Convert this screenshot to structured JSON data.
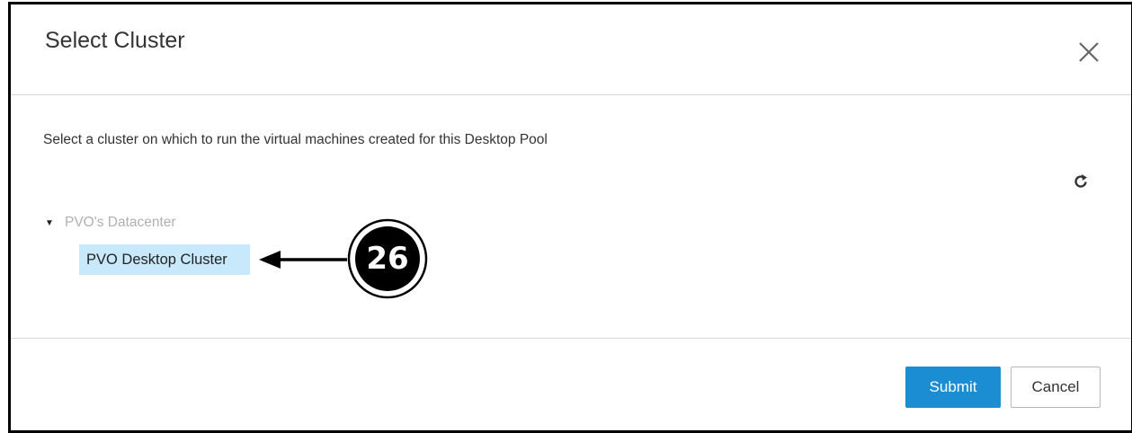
{
  "dialog": {
    "title": "Select Cluster",
    "close_icon": "close-icon",
    "description": "Select a cluster on which to run the virtual machines created for this Desktop Pool",
    "refresh_icon": "refresh-icon"
  },
  "tree": {
    "root": {
      "label": "PVO's Datacenter",
      "expanded": true,
      "icon": "caret-down-icon"
    },
    "children": [
      {
        "label": "PVO Desktop Cluster",
        "selected": true
      }
    ]
  },
  "callout": {
    "number": "26"
  },
  "footer": {
    "submit_label": "Submit",
    "cancel_label": "Cancel"
  },
  "colors": {
    "accent": "#1b8dd2",
    "selection": "#c8e8fb",
    "muted_text": "#b0b0b0"
  }
}
